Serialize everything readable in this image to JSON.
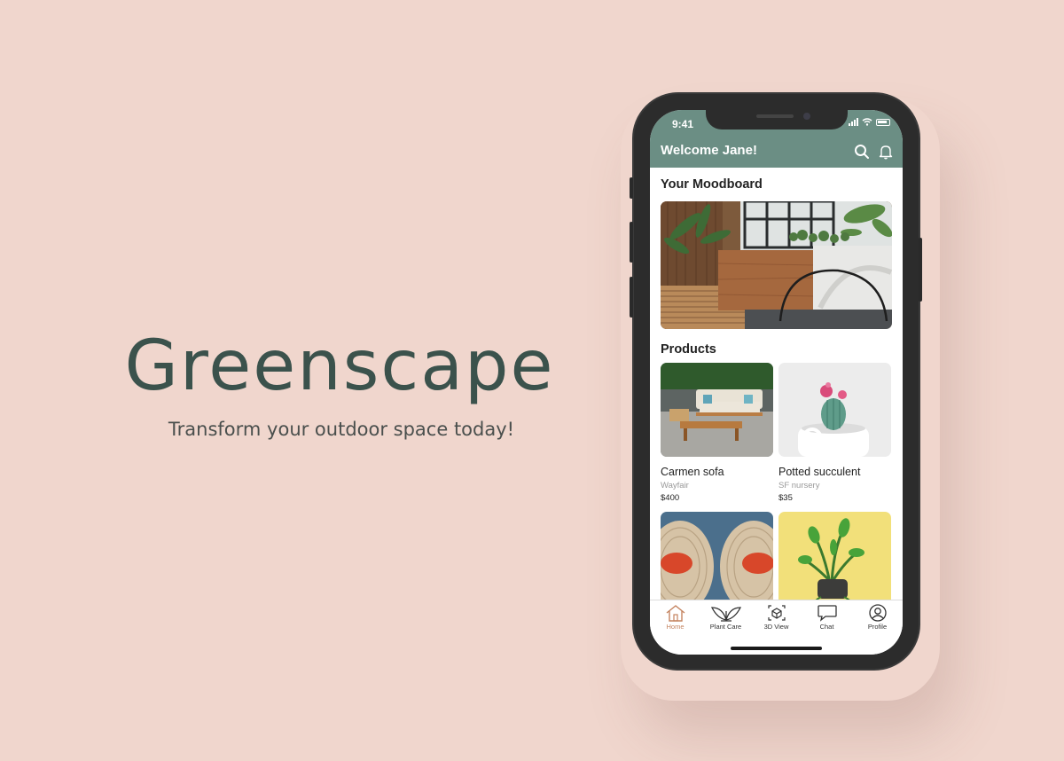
{
  "hero": {
    "title": "Greenscape",
    "tagline": "Transform your outdoor space today!"
  },
  "colors": {
    "background": "#f0d6cd",
    "header": "#6b8e84",
    "accent": "#c4835f",
    "title": "#3b524c"
  },
  "status_bar": {
    "time": "9:41"
  },
  "header": {
    "welcome": "Welcome Jane!",
    "icons": [
      "search-icon",
      "bell-icon"
    ]
  },
  "moodboard": {
    "title": "Your Moodboard"
  },
  "products": {
    "title": "Products",
    "items": [
      {
        "name": "Carmen sofa",
        "vendor": "Wayfair",
        "price": "$400"
      },
      {
        "name": "Potted succulent",
        "vendor": "SF nursery",
        "price": "$35"
      },
      {
        "name": "",
        "vendor": "",
        "price": ""
      },
      {
        "name": "",
        "vendor": "",
        "price": ""
      }
    ]
  },
  "tabs": [
    {
      "label": "Home",
      "icon": "home-icon",
      "active": true
    },
    {
      "label": "Plant Care",
      "icon": "leaves-icon",
      "active": false
    },
    {
      "label": "3D View",
      "icon": "cube-icon",
      "active": false
    },
    {
      "label": "Chat",
      "icon": "chat-bubble-icon",
      "active": false
    },
    {
      "label": "Profile",
      "icon": "profile-icon",
      "active": false
    }
  ]
}
